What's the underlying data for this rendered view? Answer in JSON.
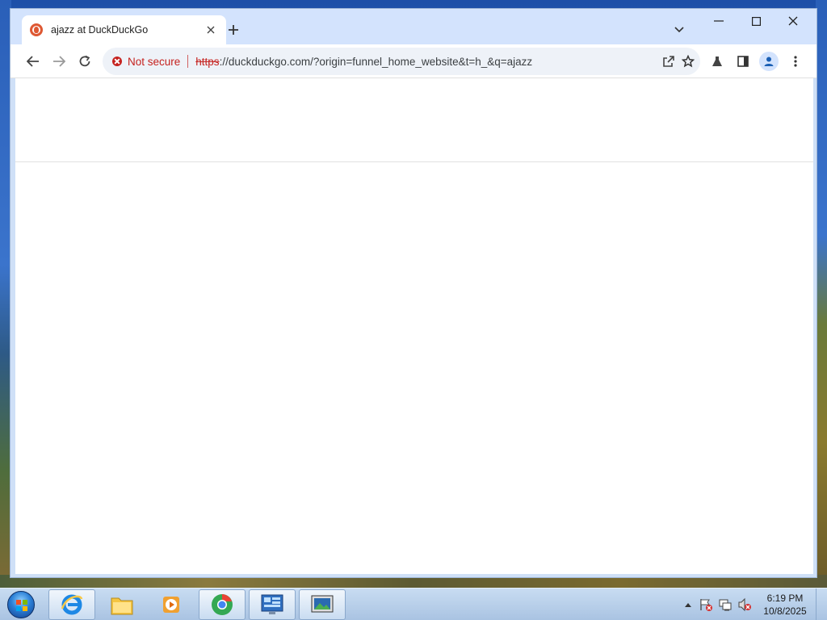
{
  "browser": {
    "tab": {
      "title": "ajazz at DuckDuckGo",
      "favicon": "duckduckgo-icon"
    },
    "omnibox": {
      "security_label": "Not secure",
      "url_scheme": "https",
      "url_rest": "://duckduckgo.com/?origin=funnel_home_website&t=h_&q=ajazz"
    },
    "toolbar_icons": [
      "back-icon",
      "forward-icon",
      "reload-icon",
      "share-icon",
      "bookmark-star-icon",
      "labs-flask-icon",
      "side-panel-icon",
      "profile-icon",
      "menu-icon"
    ],
    "window_controls": [
      "minimize-icon",
      "maximize-icon",
      "close-icon"
    ]
  },
  "taskbar": {
    "apps": [
      "internet-explorer-icon",
      "file-explorer-icon",
      "media-player-icon",
      "browser-app-icon",
      "control-panel-icon",
      "screen-app-icon"
    ],
    "tray_icons": [
      "show-hidden-icons",
      "network-error-icon",
      "network-icon",
      "volume-muted-icon"
    ],
    "clock": {
      "time": "6:19 PM",
      "date": "10/8/2025"
    }
  },
  "colors": {
    "titlebar": "#d3e3fd",
    "not_secure": "#c5221f",
    "omnibox_bg": "#eef2f8",
    "taskbar": "#b9d0ea"
  }
}
